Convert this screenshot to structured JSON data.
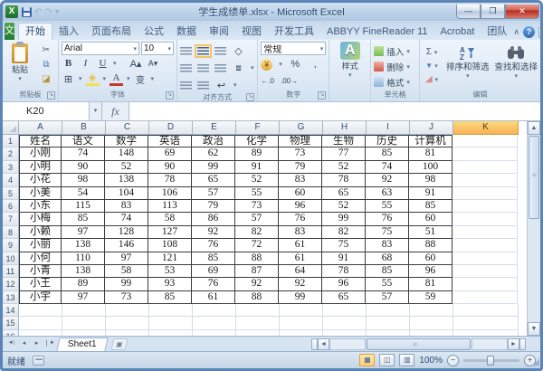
{
  "window": {
    "title": "学生成绩单.xlsx - Microsoft Excel",
    "app_initial": "X",
    "controls": {
      "minimize": "—",
      "maximize": "❐",
      "close": "✕"
    },
    "qat": {
      "undo": "↶",
      "redo": "↷",
      "dropdown": "▾"
    }
  },
  "ribbon": {
    "file_tab": "文件",
    "active_tab": "开始",
    "tabs": [
      "开始",
      "插入",
      "页面布局",
      "公式",
      "数据",
      "审阅",
      "视图",
      "开发工具",
      "ABBYY FineReader 11",
      "Acrobat",
      "团队"
    ],
    "collapse_icon": "∧",
    "help_label": "?",
    "groups": {
      "clipboard": {
        "label": "剪贴板",
        "paste": "粘贴",
        "cut": "✂",
        "copy": "⧉",
        "painter": "🖌"
      },
      "font": {
        "label": "字体",
        "family": "Arial",
        "size": "10",
        "bold": "B",
        "italic": "I",
        "underline": "U",
        "grow": "A▴",
        "shrink": "A▾",
        "border": "⊞",
        "fill": "◆",
        "color": "A",
        "phonetic": "变"
      },
      "alignment": {
        "label": "对齐方式",
        "orientation": "◇",
        "merge": "⧈"
      },
      "number": {
        "label": "数字",
        "format": "常规",
        "currency": "¥",
        "percent": "%",
        "comma": "٫",
        "inc": "⁺·⁰",
        "dec": "·⁰⁰"
      },
      "styles": {
        "button": "样式"
      },
      "cells": {
        "label": "单元格",
        "insert": "插入",
        "delete": "删除",
        "format": "格式"
      },
      "editing": {
        "label": "编辑",
        "autosum": "Σ",
        "fill": "▼",
        "clear": "◢",
        "sort_filter": "排序和筛选",
        "find_select": "查找和选择"
      }
    }
  },
  "formula_bar": {
    "name_box": "K20",
    "fx": "fx",
    "formula": ""
  },
  "grid": {
    "columns": [
      "A",
      "B",
      "C",
      "D",
      "E",
      "F",
      "G",
      "H",
      "I",
      "J",
      "K"
    ],
    "selected_column": "K",
    "selected_cell": "K20",
    "row_count": 16,
    "table_row_count": 13,
    "headers": [
      "姓名",
      "语文",
      "数学",
      "英语",
      "政治",
      "化学",
      "物理",
      "生物",
      "历史",
      "计算机"
    ],
    "rows": [
      [
        "小刚",
        74,
        148,
        69,
        62,
        89,
        73,
        77,
        85,
        81
      ],
      [
        "小明",
        90,
        52,
        90,
        99,
        91,
        79,
        52,
        74,
        100
      ],
      [
        "小花",
        98,
        138,
        78,
        65,
        52,
        83,
        78,
        92,
        98
      ],
      [
        "小美",
        54,
        104,
        106,
        57,
        55,
        60,
        65,
        63,
        91
      ],
      [
        "小东",
        115,
        83,
        113,
        79,
        73,
        96,
        52,
        55,
        85
      ],
      [
        "小梅",
        85,
        74,
        58,
        86,
        57,
        76,
        99,
        76,
        60
      ],
      [
        "小赖",
        97,
        128,
        127,
        92,
        82,
        83,
        82,
        75,
        51
      ],
      [
        "小丽",
        138,
        146,
        108,
        76,
        72,
        61,
        75,
        83,
        88
      ],
      [
        "小何",
        110,
        97,
        121,
        85,
        88,
        61,
        91,
        68,
        60
      ],
      [
        "小青",
        138,
        58,
        53,
        69,
        87,
        64,
        78,
        85,
        96
      ],
      [
        "小王",
        89,
        99,
        93,
        76,
        92,
        92,
        96,
        55,
        81
      ],
      [
        "小宇",
        97,
        73,
        85,
        61,
        88,
        99,
        65,
        57,
        59
      ]
    ]
  },
  "sheet_bar": {
    "active_tab": "Sheet1"
  },
  "status_bar": {
    "status": "就绪",
    "zoom": "100%"
  },
  "colors": {
    "file_tab_green": "#2e8f3c",
    "selected_header": "#f8c35f",
    "close_red": "#c33c2a",
    "accent_blue": "#5b85b7"
  }
}
